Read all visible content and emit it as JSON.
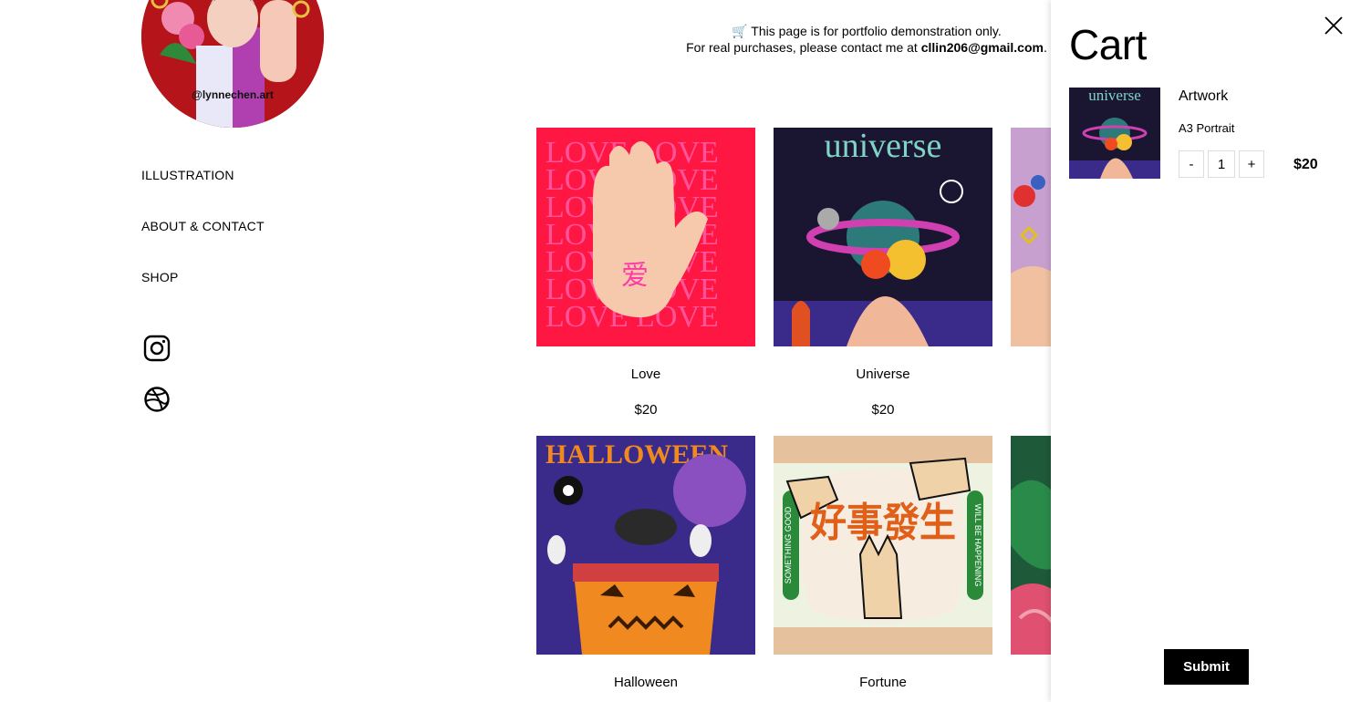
{
  "sidebar": {
    "avatar_handle": "@lynnechen.art",
    "nav": [
      "ILLUSTRATION",
      "ABOUT & CONTACT",
      "SHOP"
    ],
    "social": [
      "instagram-icon",
      "dribbble-icon"
    ]
  },
  "notice": {
    "line1": "🛒 This page is for portfolio demonstration only.",
    "line2_prefix": "For real purchases, please contact me at ",
    "email": "cllin206@gmail.com",
    "line2_suffix": "."
  },
  "products": [
    {
      "name": "Love",
      "price": "$20",
      "art_text": "LOVE",
      "glyph": "爱"
    },
    {
      "name": "Universe",
      "price": "$20",
      "art_text": "universe"
    },
    {
      "name": "Halloween",
      "price": "",
      "art_text": "HALLOWEEN"
    },
    {
      "name": "Fortune",
      "price": "",
      "glyph": "好事發生",
      "side_left": "SOMETHING GOOD",
      "side_right": "WILL BE HAPPENING"
    }
  ],
  "cart": {
    "title": "Cart",
    "item": {
      "name": "Artwork",
      "variant": "A3 Portrait",
      "minus": "-",
      "quantity": "1",
      "plus": "+",
      "price": "$20",
      "thumb_text": "universe"
    },
    "submit": "Submit"
  },
  "colors": {
    "love_bg": "#ff1744",
    "universe_bg": "#1a1530",
    "halloween_bg": "#3a2a8a",
    "fortune_bg": "#eef2e0",
    "avatar_bg": "#b4141a"
  }
}
